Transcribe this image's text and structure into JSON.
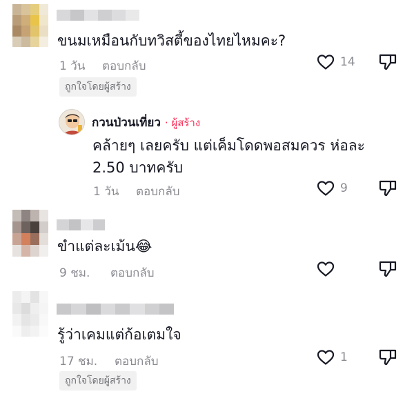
{
  "comments": [
    {
      "text": "ขนมเหมือนกับทวิสตี้ของไทยไหมคะ?",
      "time": "1 วัน",
      "reply_label": "ตอบกลับ",
      "likes": "14",
      "badge": "ถูกใจโดยผู้สร้าง",
      "avatar_colors": [
        "#c9b596",
        "#d8c39b",
        "#e4cd7c",
        "#f0e9d8",
        "#b99d78",
        "#cfae7a",
        "#e8c44a",
        "#efe6cc",
        "#a98a64",
        "#c7a274",
        "#e2c46a",
        "#eadfc4",
        "#d9cdb8",
        "#cdbba0",
        "#e6d49c",
        "#f4eee0"
      ],
      "name_blur_colors": [
        "#d8d8da",
        "#c7c7ca",
        "#e2e2e4",
        "#cfcfd2",
        "#dcdcde",
        "#e9e9ea"
      ]
    },
    {
      "author": "กวนป่วนเที่ยว",
      "creator_tag": "· ผู้สร้าง",
      "text_line1": "คล้ายๆ เลยครับ แต่เค็มโดดพอสมควร ห่อละ",
      "text_line2": "2.50 บาทครับ",
      "time": "1 วัน",
      "reply_label": "ตอบกลับ",
      "likes": "9"
    },
    {
      "text": "ขำแต่ละเม้น😂",
      "time": "9 ชม.",
      "reply_label": "ตอบกลับ",
      "likes": "",
      "avatar_colors": [
        "#c4bcb6",
        "#8e8582",
        "#bdb4b0",
        "#e7e4e2",
        "#a5958e",
        "#6d625e",
        "#4a403c",
        "#d2cdca",
        "#c8a495",
        "#d3805d",
        "#9a6e5c",
        "#e4dedb",
        "#e6e2df",
        "#d4b5a8",
        "#ded4cf",
        "#f1efee"
      ],
      "name_blur_colors": [
        "#d4d4d6",
        "#c3c3c6",
        "#e6e6e8",
        "#cdcdd0"
      ]
    },
    {
      "text": "รู้ว่าเคมแต่ก้อเตมใจ",
      "time": "17 ชม.",
      "reply_label": "ตอบกลับ",
      "likes": "1",
      "badge": "ถูกใจโดยผู้สร้าง",
      "avatar_colors": [
        "#ececec",
        "#f4f4f4",
        "#e3e3e3",
        "#f7f7f7",
        "#e8e8e8",
        "#dcdcdc",
        "#efefef",
        "#f5f5f5",
        "#f2f2f2",
        "#e5e5e5",
        "#ebebeb",
        "#f8f8f8",
        "#fafafa",
        "#eeeeee",
        "#f3f3f3",
        "#fbfbfb"
      ],
      "name_blur_colors": [
        "#c8c8ca",
        "#d6d6d8",
        "#bfbfc2",
        "#dadadc",
        "#cacacd",
        "#e0e0e2",
        "#d0d0d3",
        "#c4c4c7"
      ]
    }
  ]
}
